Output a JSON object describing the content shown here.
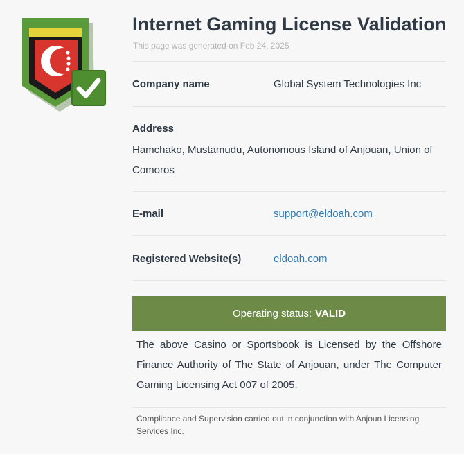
{
  "page": {
    "title": "Internet Gaming License Validation",
    "generated": "This page was generated on Feb 24, 2025"
  },
  "fields": {
    "company_label": "Company name",
    "company_value": "Global System Technologies Inc",
    "address_label": "Address",
    "address_value": "Hamchako, Mustamudu, Autonomous Island of Anjouan, Union of Comoros",
    "email_label": "E-mail",
    "email_value": "support@eldoah.com",
    "website_label": "Registered Website(s)",
    "website_value": "eldoah.com"
  },
  "status": {
    "label": "Operating status:",
    "value": "VALID",
    "color": "#6e8a47"
  },
  "description": "The above Casino or Sportsbook is Licensed by the Offshore Finance Authority of The State of Anjouan, under The Computer Gaming Licensing Act 007 of 2005.",
  "compliance": "Compliance and Supervision carried out in conjunction with Anjoun Licensing Services Inc.",
  "colors": {
    "accent_green": "#6e8a47",
    "link_blue": "#2f7ab5",
    "heading": "#2f3a45"
  },
  "logo": {
    "icon": "seal-shield-check-icon"
  }
}
